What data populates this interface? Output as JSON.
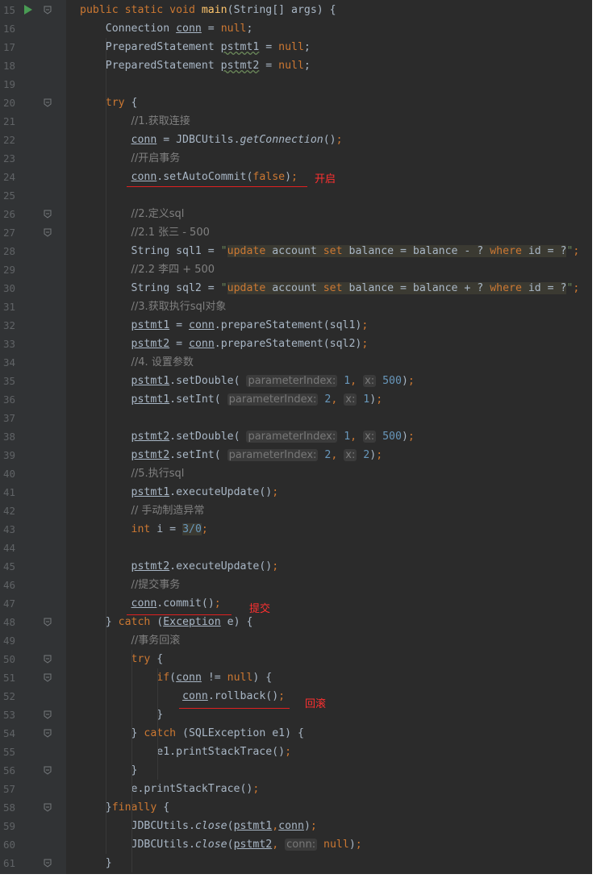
{
  "editor": {
    "lines": [
      {
        "n": "15",
        "html": "<span class='kw'>public static void </span><span class='fn'>main</span>(String[] args) {",
        "run": true,
        "fold": true
      },
      {
        "n": "16",
        "html": "    Connection <span class='var'>conn</span> = <span class='kw'>null</span>;"
      },
      {
        "n": "17",
        "html": "    PreparedStatement <span class='var wavy'>pstmt1</span> = <span class='kw'>null</span>;"
      },
      {
        "n": "18",
        "html": "    PreparedStatement <span class='var wavy'>pstmt2</span> = <span class='kw'>null</span>;"
      },
      {
        "n": "19",
        "html": ""
      },
      {
        "n": "20",
        "html": "    <span class='kw'>try </span>{",
        "fold": true
      },
      {
        "n": "21",
        "html": "        <span class='cm'>//1.获取连接</span>"
      },
      {
        "n": "22",
        "html": "        <span class='var'>conn</span> = JDBCUtils.<span class='ital'>getConnection</span>()<span class='kw'>;</span>"
      },
      {
        "n": "23",
        "html": "        <span class='cm'>//开启事务</span>"
      },
      {
        "n": "24",
        "html": "        <span class='var'>conn</span>.setAutoCommit(<span class='kw'>false</span>)<span class='kw'>;</span>"
      },
      {
        "n": "25",
        "html": ""
      },
      {
        "n": "26",
        "html": "        <span class='cm'>//2.定义sql</span>",
        "fold": true
      },
      {
        "n": "27",
        "html": "        <span class='cm'>//2.1 张三 - 500</span>",
        "fold": true
      },
      {
        "n": "28",
        "html": "        String sql1 = <span class='st'>\"</span><span class='strkw'>update</span><span class='hl'> account </span><span class='strkw'>set</span><span class='hl'> balance = balance - ? </span><span class='strkw'>where</span><span class='hl'> id = ?</span><span class='st'>\"</span><span class='kw'>;</span>"
      },
      {
        "n": "29",
        "html": "        <span class='cm'>//2.2 李四 + 500</span>"
      },
      {
        "n": "30",
        "html": "        String sql2 = <span class='st'>\"</span><span class='strkw'>update</span><span class='hl'> account </span><span class='strkw'>set</span><span class='hl'> balance = balance + ? </span><span class='strkw'>where</span><span class='hl'> id = ?</span><span class='st'>\"</span><span class='kw'>;</span>"
      },
      {
        "n": "31",
        "html": "        <span class='cm'>//3.获取执行sql对象</span>"
      },
      {
        "n": "32",
        "html": "        <span class='var'>pstmt1</span> = <span class='var'>conn</span>.prepareStatement(sql1)<span class='kw'>;</span>"
      },
      {
        "n": "33",
        "html": "        <span class='var'>pstmt2</span> = <span class='var'>conn</span>.prepareStatement(sql2)<span class='kw'>;</span>"
      },
      {
        "n": "34",
        "html": "        <span class='cm'>//4. 设置参数</span>"
      },
      {
        "n": "35",
        "html": "        <span class='var'>pstmt1</span>.setDouble( <span class='hint'>parameterIndex:</span> <span style='color:#6897bb'>1</span><span class='kw'>,</span> <span class='hint'>x:</span> <span style='color:#6897bb'>500</span>)<span class='kw'>;</span>"
      },
      {
        "n": "36",
        "html": "        <span class='var'>pstmt1</span>.setInt( <span class='hint'>parameterIndex:</span> <span style='color:#6897bb'>2</span><span class='kw'>,</span> <span class='hint'>x:</span> <span style='color:#6897bb'>1</span>)<span class='kw'>;</span>"
      },
      {
        "n": "37",
        "html": ""
      },
      {
        "n": "38",
        "html": "        <span class='var'>pstmt2</span>.setDouble( <span class='hint'>parameterIndex:</span> <span style='color:#6897bb'>1</span><span class='kw'>,</span> <span class='hint'>x:</span> <span style='color:#6897bb'>500</span>)<span class='kw'>;</span>"
      },
      {
        "n": "39",
        "html": "        <span class='var'>pstmt2</span>.setInt( <span class='hint'>parameterIndex:</span> <span style='color:#6897bb'>2</span><span class='kw'>,</span> <span class='hint'>x:</span> <span style='color:#6897bb'>2</span>)<span class='kw'>;</span>"
      },
      {
        "n": "40",
        "html": "        <span class='cm'>//5.执行sql</span>"
      },
      {
        "n": "41",
        "html": "        <span class='var'>pstmt1</span>.executeUpdate()<span class='kw'>;</span>"
      },
      {
        "n": "42",
        "html": "        <span class='cm'>// 手动制造异常</span>"
      },
      {
        "n": "43",
        "html": "        <span class='kw'>int </span>i = <span class='hl' style='color:#6897bb'>3/0</span><span class='kw'>;</span>"
      },
      {
        "n": "44",
        "html": ""
      },
      {
        "n": "45",
        "html": "        <span class='var'>pstmt2</span>.executeUpdate()<span class='kw'>;</span>"
      },
      {
        "n": "46",
        "html": "        <span class='cm'>//提交事务</span>"
      },
      {
        "n": "47",
        "html": "        <span class='var'>conn</span>.commit()<span class='kw'>;</span>"
      },
      {
        "n": "48",
        "html": "    } <span class='kw'>catch </span>(<span class='var'>Exception</span> e) {",
        "fold": true
      },
      {
        "n": "49",
        "html": "        <span class='cm'>//事务回滚</span>"
      },
      {
        "n": "50",
        "html": "        <span class='kw'>try </span>{",
        "fold": true
      },
      {
        "n": "51",
        "html": "            <span class='kw'>if</span>(<span class='var'>conn</span> != <span class='kw'>null</span>) {",
        "fold": true
      },
      {
        "n": "52",
        "html": "                <span class='var'>conn</span>.rollback()<span class='kw'>;</span>"
      },
      {
        "n": "53",
        "html": "            }",
        "fold": true
      },
      {
        "n": "54",
        "html": "        } <span class='kw'>catch </span>(SQLException e1) {",
        "fold": true
      },
      {
        "n": "55",
        "html": "            e1.printStackTrace()<span class='kw'>;</span>"
      },
      {
        "n": "56",
        "html": "        }",
        "fold": true
      },
      {
        "n": "57",
        "html": "        e.printStackTrace()<span class='kw'>;</span>"
      },
      {
        "n": "58",
        "html": "    }<span class='kw'>finally </span>{",
        "fold": true
      },
      {
        "n": "59",
        "html": "        JDBCUtils.<span class='ital'>close</span>(<span class='var'>pstmt1</span><span class='kw'>,</span><span class='var'>conn</span>)<span class='kw'>;</span>"
      },
      {
        "n": "60",
        "html": "        JDBCUtils.<span class='ital'>close</span>(<span class='var'>pstmt2</span><span class='kw'>,</span> <span class='hint'>conn:</span> <span class='kw'>null</span>)<span class='kw'>;</span>"
      },
      {
        "n": "61",
        "html": "    }",
        "fold": true
      }
    ]
  },
  "notes": {
    "open": "开启",
    "commit": "提交",
    "rollback": "回滚"
  }
}
